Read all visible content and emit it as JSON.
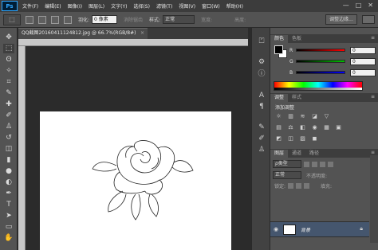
{
  "app": {
    "logo": "Ps"
  },
  "menu": {
    "items": [
      "文件(F)",
      "编辑(E)",
      "图像(I)",
      "图层(L)",
      "文字(Y)",
      "选择(S)",
      "滤镜(T)",
      "视图(V)",
      "窗口(W)",
      "帮助(H)"
    ],
    "window_controls": [
      "—",
      "□",
      "✕"
    ]
  },
  "options": {
    "feather_label": "羽化:",
    "feather_value": "0 像素",
    "antialias_label": "消除锯齿",
    "style_label": "样式:",
    "style_value": "正常",
    "width_label": "宽度:",
    "height_label": "高度:",
    "refine_edge_label": "调整边缘..."
  },
  "document": {
    "tab_title": "QQ截图20160411124812.jpg @ 66.7%(RGB/8#)",
    "close_glyph": "×"
  },
  "color_panel": {
    "tabs": [
      "颜色",
      "色板"
    ],
    "channels": [
      {
        "label": "R",
        "value": "0",
        "gradient": "#ff0000"
      },
      {
        "label": "G",
        "value": "0",
        "gradient": "#00c000"
      },
      {
        "label": "B",
        "value": "0",
        "gradient": "#0000ff"
      }
    ]
  },
  "adjust_panel": {
    "tabs": [
      "调整",
      "样式"
    ],
    "title": "添加调整",
    "row1_icons": [
      "☼",
      "▥",
      "≋",
      "◪",
      "▽"
    ],
    "row2_icons": [
      "▤",
      "⚖",
      "◧",
      "◉",
      "▦",
      "▣"
    ],
    "row3_icons": [
      "◩",
      "◫",
      "▨",
      "◼"
    ]
  },
  "layers_panel": {
    "tabs": [
      "图层",
      "通道",
      "路径"
    ],
    "kind_value": "ρ类型",
    "blend_mode": "正常",
    "opacity_label": "不透明度:",
    "lock_label": "锁定:",
    "fill_label": "填充:",
    "layer_name": "背景"
  },
  "colors": {
    "menubar": "#3c3c3c",
    "panel": "#535353",
    "workspace": "#2b2b2b",
    "selected_layer": "#45566e"
  }
}
